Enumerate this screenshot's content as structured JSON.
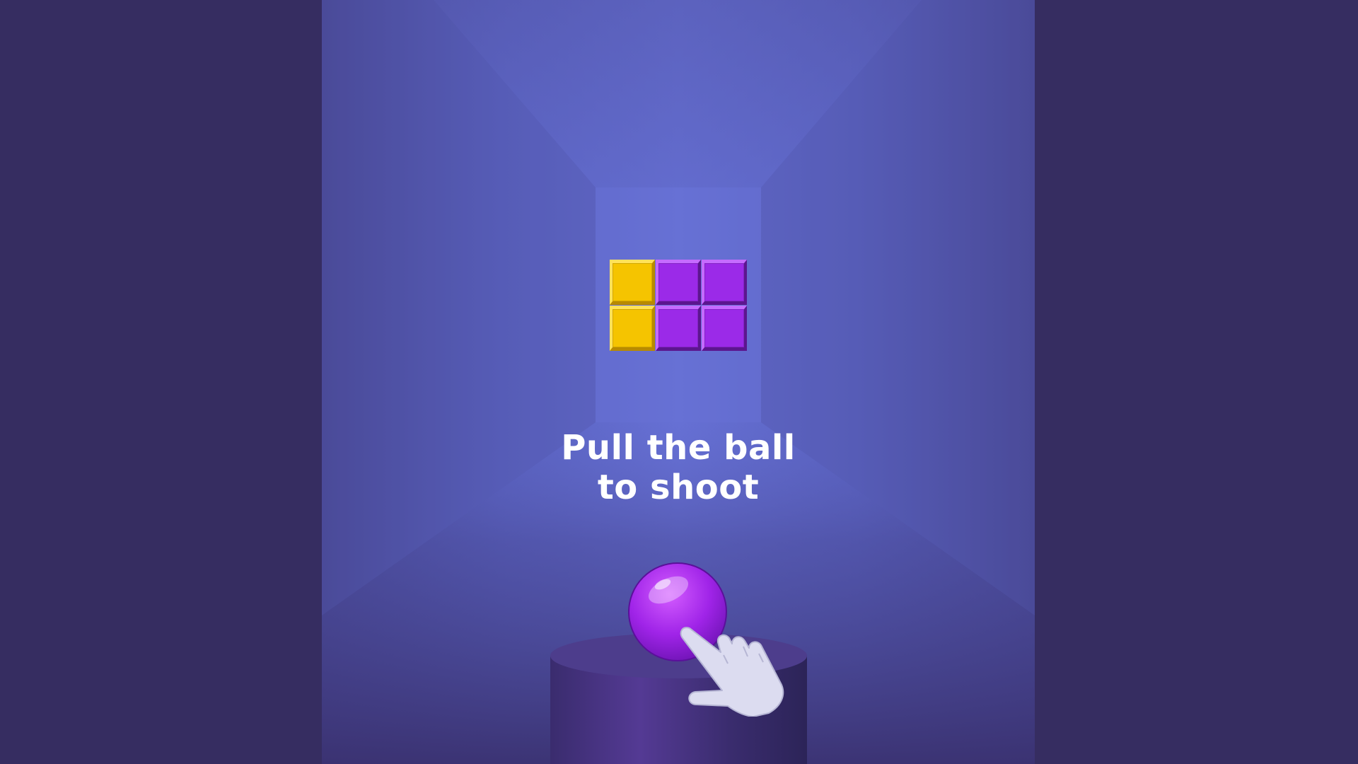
{
  "hint": {
    "line1": "Pull the ball",
    "line2": "to shoot"
  },
  "bricks": {
    "rows": 2,
    "cols": 3,
    "colors": [
      [
        "yellow",
        "purple",
        "purple"
      ],
      [
        "yellow",
        "purple",
        "purple"
      ]
    ]
  },
  "palette": {
    "background": "#362d61",
    "room_center": "#6670d4",
    "room_edge": "#4a4a98",
    "yellow": "#f5c400",
    "purple": "#9b2ae8",
    "ball": "#9f22e6",
    "pedestal": "#3f2f74",
    "hand": "#dcdcf0"
  },
  "icons": {
    "tutorial_hand": "pointing-hand-icon"
  }
}
